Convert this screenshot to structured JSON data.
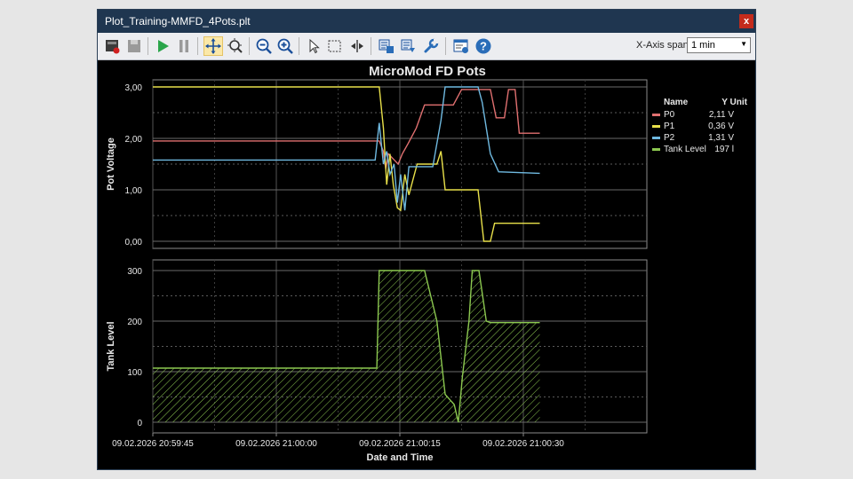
{
  "window": {
    "title": "Plot_Training-MMFD_4Pots.plt",
    "close_glyph": "x"
  },
  "toolbar": {
    "buttons": [
      {
        "name": "record-icon",
        "active": false
      },
      {
        "name": "save-icon",
        "active": false
      },
      {
        "name": "play-icon",
        "active": false
      },
      {
        "name": "pause-icon",
        "active": false
      },
      {
        "name": "pan-icon",
        "active": true
      },
      {
        "name": "zoom-region-icon",
        "active": false
      },
      {
        "name": "zoom-out-icon",
        "active": false
      },
      {
        "name": "zoom-in-icon",
        "active": false
      },
      {
        "name": "pointer-icon",
        "active": false
      },
      {
        "name": "select-rect-icon",
        "active": false
      },
      {
        "name": "split-icon",
        "active": false
      },
      {
        "name": "export-icon",
        "active": false
      },
      {
        "name": "import-icon",
        "active": false
      },
      {
        "name": "settings-wrench-icon",
        "active": false
      },
      {
        "name": "properties-icon",
        "active": false
      },
      {
        "name": "help-icon",
        "active": false
      }
    ],
    "xspan_label": "X-Axis span:",
    "xspan_value": "1 min"
  },
  "chart_data": {
    "type": "line",
    "title": "MicroMod FD Pots",
    "xlabel": "Date and Time",
    "x_unit": "seconds",
    "x_ticks": [
      "09.02.2026 20:59:45",
      "09.02.2026 21:00:00",
      "09.02.2026 21:00:15",
      "09.02.2026 21:00:30"
    ],
    "x_tick_values": [
      0,
      15,
      30,
      45
    ],
    "xlim": [
      0,
      60
    ],
    "grid": true,
    "legend": {
      "placement": "top-right",
      "header_name": "Name",
      "header_unit": "Y Unit"
    },
    "panels": [
      {
        "ylabel": "Pot Voltage",
        "ylim": [
          0,
          3
        ],
        "y_ticks": [
          "0,00",
          "1,00",
          "2,00",
          "3,00"
        ],
        "y_tick_values": [
          0,
          1,
          2,
          3
        ],
        "series": [
          {
            "name": "P0",
            "unit_value": "2,11 V",
            "color": "#e07070",
            "points": [
              [
                0,
                1.95
              ],
              [
                27.5,
                1.95
              ],
              [
                28,
                1.75
              ],
              [
                28.3,
                1.4
              ],
              [
                28.6,
                1.7
              ],
              [
                29.2,
                1.6
              ],
              [
                29.8,
                1.5
              ],
              [
                30.3,
                1.7
              ],
              [
                31,
                1.9
              ],
              [
                32,
                2.2
              ],
              [
                33,
                2.65
              ],
              [
                35,
                2.65
              ],
              [
                36.5,
                2.65
              ],
              [
                37.5,
                2.95
              ],
              [
                41,
                2.95
              ],
              [
                41.7,
                2.4
              ],
              [
                42.7,
                2.4
              ],
              [
                43.2,
                2.95
              ],
              [
                44,
                2.95
              ],
              [
                44.5,
                2.1
              ],
              [
                47,
                2.1
              ]
            ]
          },
          {
            "name": "P1",
            "unit_value": "0,36 V",
            "color": "#e8e04a",
            "points": [
              [
                0,
                3
              ],
              [
                27.5,
                3
              ],
              [
                28,
                2.2
              ],
              [
                28.4,
                1.1
              ],
              [
                28.8,
                1.7
              ],
              [
                29.2,
                1.1
              ],
              [
                29.7,
                0.65
              ],
              [
                30.1,
                0.6
              ],
              [
                30.6,
                1.3
              ],
              [
                31.1,
                0.9
              ],
              [
                31.6,
                1.2
              ],
              [
                32.1,
                1.5
              ],
              [
                33.5,
                1.5
              ],
              [
                34.5,
                1.5
              ],
              [
                35,
                1.75
              ],
              [
                35.5,
                1.0
              ],
              [
                39.5,
                1.0
              ],
              [
                40.2,
                0.0
              ],
              [
                41,
                0.0
              ],
              [
                41.5,
                0.35
              ],
              [
                47,
                0.35
              ]
            ]
          },
          {
            "name": "P2",
            "unit_value": "1,31 V",
            "color": "#6fb9e0",
            "points": [
              [
                0,
                1.58
              ],
              [
                27,
                1.58
              ],
              [
                27.5,
                2.3
              ],
              [
                28,
                1.5
              ],
              [
                28.4,
                1.75
              ],
              [
                28.8,
                1.3
              ],
              [
                29.3,
                1.5
              ],
              [
                29.7,
                0.75
              ],
              [
                30.1,
                1.3
              ],
              [
                30.6,
                0.6
              ],
              [
                31.1,
                1.45
              ],
              [
                32,
                1.45
              ],
              [
                34,
                1.45
              ],
              [
                35,
                2.35
              ],
              [
                35.5,
                3.0
              ],
              [
                39.5,
                3.0
              ],
              [
                40,
                2.7
              ],
              [
                41,
                1.7
              ],
              [
                42,
                1.35
              ],
              [
                47,
                1.32
              ]
            ]
          }
        ]
      },
      {
        "ylabel": "Tank Level",
        "ylim": [
          0,
          300
        ],
        "y_ticks": [
          "0",
          "100",
          "200",
          "300"
        ],
        "y_tick_values": [
          0,
          100,
          200,
          300
        ],
        "series": [
          {
            "name": "Tank Level",
            "unit_value": "197 l",
            "color": "#8cc850",
            "fill": "hatched",
            "points": [
              [
                0,
                107
              ],
              [
                27.2,
                107
              ],
              [
                27.5,
                300
              ],
              [
                33,
                300
              ],
              [
                34.5,
                200
              ],
              [
                35.5,
                55
              ],
              [
                36.6,
                35
              ],
              [
                37.1,
                0
              ],
              [
                37.6,
                90
              ],
              [
                38.4,
                200
              ],
              [
                38.8,
                300
              ],
              [
                39.6,
                300
              ],
              [
                40.5,
                200
              ],
              [
                41,
                197
              ],
              [
                47,
                197
              ]
            ]
          }
        ]
      }
    ]
  }
}
